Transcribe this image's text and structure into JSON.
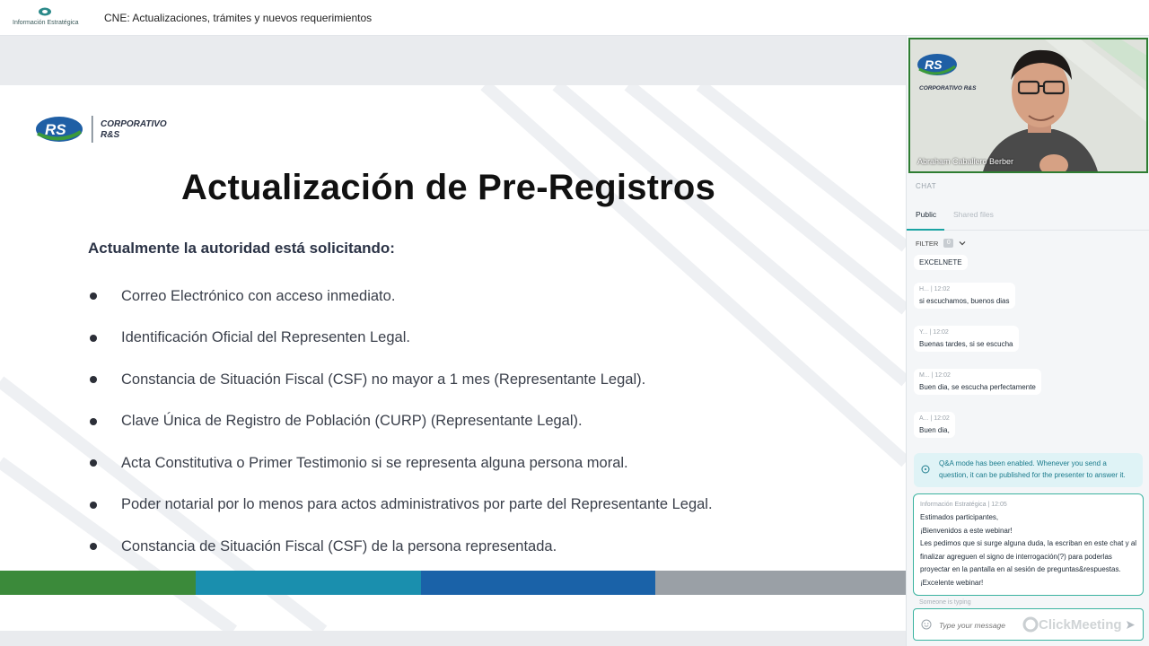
{
  "header": {
    "brand_name": "Información Estratégica",
    "title": "CNE: Actualizaciones, trámites y nuevos requerimientos"
  },
  "slide": {
    "logo_text_line1": "CORPORATIVO",
    "logo_text_line2": "R&S",
    "logo_mark": "RS",
    "heading": "Actualización de Pre-Registros",
    "subheading": "Actualmente la autoridad está solicitando:",
    "bullets": [
      "Correo Electrónico con acceso inmediato.",
      "Identificación Oficial del Representen Legal.",
      "Constancia de Situación Fiscal (CSF) no mayor a 1 mes (Representante Legal).",
      "Clave Única de Registro de Población (CURP)  (Representante Legal).",
      "Acta Constitutiva o Primer Testimonio si se representa alguna persona moral.",
      "Poder notarial por lo menos para actos administrativos por parte del Representante Legal.",
      "Constancia de Situación Fiscal (CSF) de la persona representada."
    ],
    "stripe_colors": [
      "#3b8a3a",
      "#1a8fae",
      "#1a62a8",
      "#9aa0a6"
    ]
  },
  "video": {
    "presenter_name": "Abraham Caballero Berber",
    "overlay_logo_mark": "RS",
    "overlay_logo_text": "CORPORATIVO R&S"
  },
  "chat": {
    "section_label": "CHAT",
    "tabs": {
      "public": "Public",
      "shared_files": "Shared files"
    },
    "filter_label": "FILTER",
    "filter_count": "0",
    "messages": [
      {
        "meta": "",
        "text": "EXCELNETE"
      },
      {
        "meta": "H...  |  12:02",
        "text": "si escuchamos, buenos dias"
      },
      {
        "meta": "Y...  |  12:02",
        "text": "Buenas tardes, si se escucha"
      },
      {
        "meta": "M...  |  12:02",
        "text": "Buen dia, se escucha perfectamente"
      },
      {
        "meta": "A...  |  12:02",
        "text": "Buen dia,"
      }
    ],
    "notice": "Q&A mode has been enabled. Whenever you send a question, it can be published for the presenter to answer it.",
    "announcement": {
      "meta": "Información Estratégica  |  12:05",
      "lines": [
        "Estimados participantes,",
        "¡Bienvenidos a este webinar!",
        "Les pedimos que si surge alguna duda, la escriban en este chat y al",
        "finalizar agreguen el signo de interrogación(?) para poderlas",
        "proyectar en la pantalla en al sesión de preguntas&respuestas.",
        "¡Excelente webinar!"
      ]
    },
    "typing": "Someone is typing",
    "input_placeholder": "Type your message",
    "watermark": "ClickMeeting"
  },
  "colors": {
    "accent": "#1aa3a3",
    "slide_heading": "#111111",
    "sub_heading": "#2b3346"
  }
}
